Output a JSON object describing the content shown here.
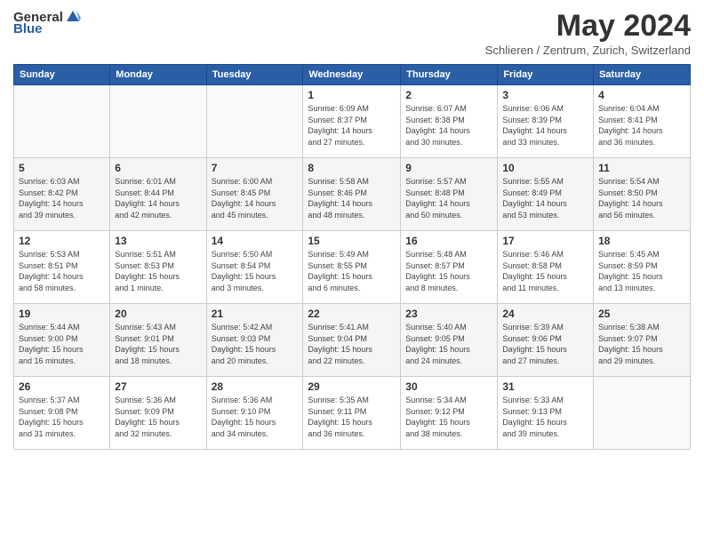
{
  "header": {
    "logo": {
      "text_general": "General",
      "text_blue": "Blue"
    },
    "title": "May 2024",
    "subtitle": "Schlieren / Zentrum, Zurich, Switzerland"
  },
  "days_of_week": [
    "Sunday",
    "Monday",
    "Tuesday",
    "Wednesday",
    "Thursday",
    "Friday",
    "Saturday"
  ],
  "weeks": [
    {
      "days": [
        {
          "num": "",
          "info": ""
        },
        {
          "num": "",
          "info": ""
        },
        {
          "num": "",
          "info": ""
        },
        {
          "num": "1",
          "info": "Sunrise: 6:09 AM\nSunset: 8:37 PM\nDaylight: 14 hours\nand 27 minutes."
        },
        {
          "num": "2",
          "info": "Sunrise: 6:07 AM\nSunset: 8:38 PM\nDaylight: 14 hours\nand 30 minutes."
        },
        {
          "num": "3",
          "info": "Sunrise: 6:06 AM\nSunset: 8:39 PM\nDaylight: 14 hours\nand 33 minutes."
        },
        {
          "num": "4",
          "info": "Sunrise: 6:04 AM\nSunset: 8:41 PM\nDaylight: 14 hours\nand 36 minutes."
        }
      ]
    },
    {
      "days": [
        {
          "num": "5",
          "info": "Sunrise: 6:03 AM\nSunset: 8:42 PM\nDaylight: 14 hours\nand 39 minutes."
        },
        {
          "num": "6",
          "info": "Sunrise: 6:01 AM\nSunset: 8:44 PM\nDaylight: 14 hours\nand 42 minutes."
        },
        {
          "num": "7",
          "info": "Sunrise: 6:00 AM\nSunset: 8:45 PM\nDaylight: 14 hours\nand 45 minutes."
        },
        {
          "num": "8",
          "info": "Sunrise: 5:58 AM\nSunset: 8:46 PM\nDaylight: 14 hours\nand 48 minutes."
        },
        {
          "num": "9",
          "info": "Sunrise: 5:57 AM\nSunset: 8:48 PM\nDaylight: 14 hours\nand 50 minutes."
        },
        {
          "num": "10",
          "info": "Sunrise: 5:55 AM\nSunset: 8:49 PM\nDaylight: 14 hours\nand 53 minutes."
        },
        {
          "num": "11",
          "info": "Sunrise: 5:54 AM\nSunset: 8:50 PM\nDaylight: 14 hours\nand 56 minutes."
        }
      ]
    },
    {
      "days": [
        {
          "num": "12",
          "info": "Sunrise: 5:53 AM\nSunset: 8:51 PM\nDaylight: 14 hours\nand 58 minutes."
        },
        {
          "num": "13",
          "info": "Sunrise: 5:51 AM\nSunset: 8:53 PM\nDaylight: 15 hours\nand 1 minute."
        },
        {
          "num": "14",
          "info": "Sunrise: 5:50 AM\nSunset: 8:54 PM\nDaylight: 15 hours\nand 3 minutes."
        },
        {
          "num": "15",
          "info": "Sunrise: 5:49 AM\nSunset: 8:55 PM\nDaylight: 15 hours\nand 6 minutes."
        },
        {
          "num": "16",
          "info": "Sunrise: 5:48 AM\nSunset: 8:57 PM\nDaylight: 15 hours\nand 8 minutes."
        },
        {
          "num": "17",
          "info": "Sunrise: 5:46 AM\nSunset: 8:58 PM\nDaylight: 15 hours\nand 11 minutes."
        },
        {
          "num": "18",
          "info": "Sunrise: 5:45 AM\nSunset: 8:59 PM\nDaylight: 15 hours\nand 13 minutes."
        }
      ]
    },
    {
      "days": [
        {
          "num": "19",
          "info": "Sunrise: 5:44 AM\nSunset: 9:00 PM\nDaylight: 15 hours\nand 16 minutes."
        },
        {
          "num": "20",
          "info": "Sunrise: 5:43 AM\nSunset: 9:01 PM\nDaylight: 15 hours\nand 18 minutes."
        },
        {
          "num": "21",
          "info": "Sunrise: 5:42 AM\nSunset: 9:03 PM\nDaylight: 15 hours\nand 20 minutes."
        },
        {
          "num": "22",
          "info": "Sunrise: 5:41 AM\nSunset: 9:04 PM\nDaylight: 15 hours\nand 22 minutes."
        },
        {
          "num": "23",
          "info": "Sunrise: 5:40 AM\nSunset: 9:05 PM\nDaylight: 15 hours\nand 24 minutes."
        },
        {
          "num": "24",
          "info": "Sunrise: 5:39 AM\nSunset: 9:06 PM\nDaylight: 15 hours\nand 27 minutes."
        },
        {
          "num": "25",
          "info": "Sunrise: 5:38 AM\nSunset: 9:07 PM\nDaylight: 15 hours\nand 29 minutes."
        }
      ]
    },
    {
      "days": [
        {
          "num": "26",
          "info": "Sunrise: 5:37 AM\nSunset: 9:08 PM\nDaylight: 15 hours\nand 31 minutes."
        },
        {
          "num": "27",
          "info": "Sunrise: 5:36 AM\nSunset: 9:09 PM\nDaylight: 15 hours\nand 32 minutes."
        },
        {
          "num": "28",
          "info": "Sunrise: 5:36 AM\nSunset: 9:10 PM\nDaylight: 15 hours\nand 34 minutes."
        },
        {
          "num": "29",
          "info": "Sunrise: 5:35 AM\nSunset: 9:11 PM\nDaylight: 15 hours\nand 36 minutes."
        },
        {
          "num": "30",
          "info": "Sunrise: 5:34 AM\nSunset: 9:12 PM\nDaylight: 15 hours\nand 38 minutes."
        },
        {
          "num": "31",
          "info": "Sunrise: 5:33 AM\nSunset: 9:13 PM\nDaylight: 15 hours\nand 39 minutes."
        },
        {
          "num": "",
          "info": ""
        }
      ]
    }
  ]
}
